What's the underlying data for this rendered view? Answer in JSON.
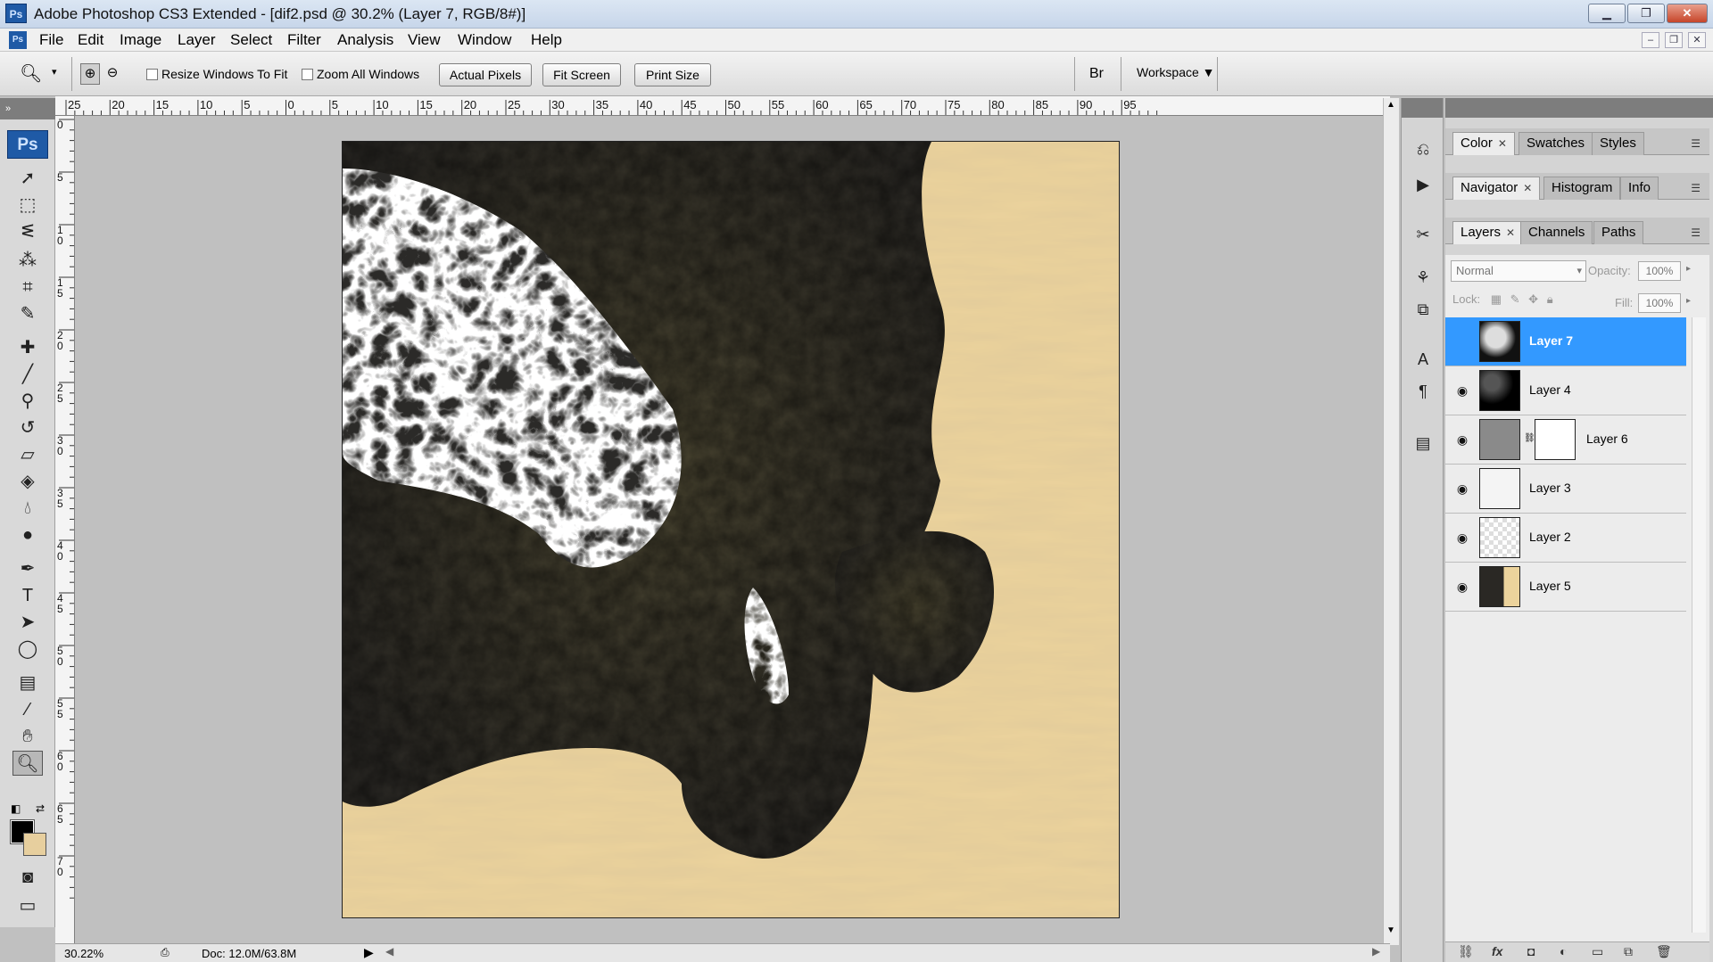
{
  "window": {
    "title": "Adobe Photoshop CS3 Extended - [dif2.psd @ 30.2% (Layer 7, RGB/8#)]",
    "app_icon": "Ps",
    "min_icon": "minimize-icon",
    "max_icon": "maximize-icon",
    "close_icon": "close-icon"
  },
  "menu": {
    "items": [
      "File",
      "Edit",
      "Image",
      "Layer",
      "Select",
      "Filter",
      "Analysis",
      "View",
      "Window",
      "Help"
    ]
  },
  "options": {
    "resize_windows": "Resize Windows To Fit",
    "zoom_all": "Zoom All Windows",
    "actual_pixels": "Actual Pixels",
    "fit_screen": "Fit Screen",
    "print_size": "Print Size",
    "workspace": "Workspace"
  },
  "toolbox": {
    "badge": "Ps",
    "tools": [
      "move-tool-icon",
      "marquee-tool-icon",
      "lasso-tool-icon",
      "magic-wand-icon",
      "crop-tool-icon",
      "slice-tool-icon",
      "healing-brush-icon",
      "brush-tool-icon",
      "clone-stamp-icon",
      "history-brush-icon",
      "eraser-icon",
      "paint-bucket-icon",
      "blur-tool-icon",
      "dodge-tool-icon",
      "pen-tool-icon",
      "type-tool-icon",
      "path-selection-icon",
      "shape-tool-icon",
      "notes-tool-icon",
      "eyedropper-icon",
      "hand-tool-icon",
      "zoom-tool-icon"
    ],
    "foreground": "#000000",
    "background": "#e7cf9e"
  },
  "rulers": {
    "h_labels": [
      "25",
      "20",
      "15",
      "10",
      "5",
      "0",
      "5",
      "10",
      "15",
      "20",
      "25",
      "30",
      "35",
      "40",
      "45",
      "50",
      "55",
      "60",
      "65",
      "70",
      "75",
      "80",
      "85",
      "90",
      "95"
    ],
    "v_labels": [
      "0",
      "5",
      "1\n0",
      "1\n5",
      "2\n0",
      "2\n5",
      "3\n0",
      "3\n5",
      "4\n0",
      "4\n5",
      "5\n0",
      "5\n5",
      "6\n0",
      "6\n5",
      "7\n0"
    ]
  },
  "status": {
    "zoom": "30.22%",
    "doc": "Doc: 12.0M/63.8M"
  },
  "panels": {
    "group1": [
      "Color",
      "Swatches",
      "Styles"
    ],
    "group2": [
      "Navigator",
      "Histogram",
      "Info"
    ],
    "group3": [
      "Layers",
      "Channels",
      "Paths"
    ],
    "blend_mode": "Normal",
    "opacity_label": "Opacity:",
    "opacity_value": "100%",
    "lock_label": "Lock:",
    "fill_label": "Fill:",
    "fill_value": "100%"
  },
  "layers": [
    {
      "name": "Layer 7",
      "visible": false,
      "selected": true
    },
    {
      "name": "Layer 4",
      "visible": true,
      "selected": false
    },
    {
      "name": "Layer 6",
      "visible": true,
      "selected": false
    },
    {
      "name": "Layer 3",
      "visible": true,
      "selected": false
    },
    {
      "name": "Layer 2",
      "visible": true,
      "selected": false
    },
    {
      "name": "Layer 5",
      "visible": true,
      "selected": false
    }
  ],
  "colors": {
    "sand": "#ecd39c",
    "terrain_dark": "#2a2925",
    "terrain_olive": "#4b4630",
    "selection": "#3399ff"
  }
}
